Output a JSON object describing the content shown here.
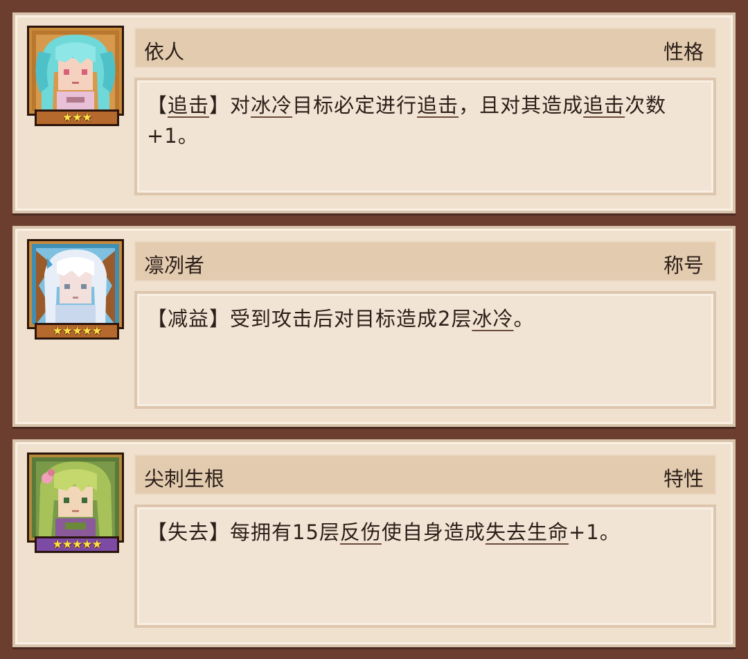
{
  "cards": [
    {
      "name": "依人",
      "category": "性格",
      "stars": "★★★",
      "desc": [
        {
          "t": "【"
        },
        {
          "t": "追击",
          "kw": true
        },
        {
          "t": "】对"
        },
        {
          "t": "冰冷",
          "kw": true
        },
        {
          "t": "目标必定进行"
        },
        {
          "t": "追击",
          "kw": true
        },
        {
          "t": "，且对其造成"
        },
        {
          "t": "追击",
          "kw": true
        },
        {
          "t": "次数+1。"
        }
      ],
      "portrait_colors": {
        "hair": "#6fd8d8",
        "skin": "#f5d2c0",
        "bg": "#b9782e"
      }
    },
    {
      "name": "凛冽者",
      "category": "称号",
      "stars": "★★★★★",
      "desc": [
        {
          "t": "【减益】受到攻击后对目标造成2层"
        },
        {
          "t": "冰冷",
          "kw": true
        },
        {
          "t": "。"
        }
      ],
      "portrait_colors": {
        "hair": "#e8eef8",
        "skin": "#f3e0dc",
        "bg": "#3f8fb5"
      }
    },
    {
      "name": "尖刺生根",
      "category": "特性",
      "stars": "★★★★★",
      "desc": [
        {
          "t": "【失去】每拥有15层"
        },
        {
          "t": "反伤",
          "kw": true
        },
        {
          "t": "使自身造成"
        },
        {
          "t": "失去生命",
          "kw": true
        },
        {
          "t": "+1。"
        }
      ],
      "portrait_colors": {
        "hair": "#a8c25a",
        "skin": "#f2d6b8",
        "bg": "#5a7a3a"
      }
    }
  ]
}
